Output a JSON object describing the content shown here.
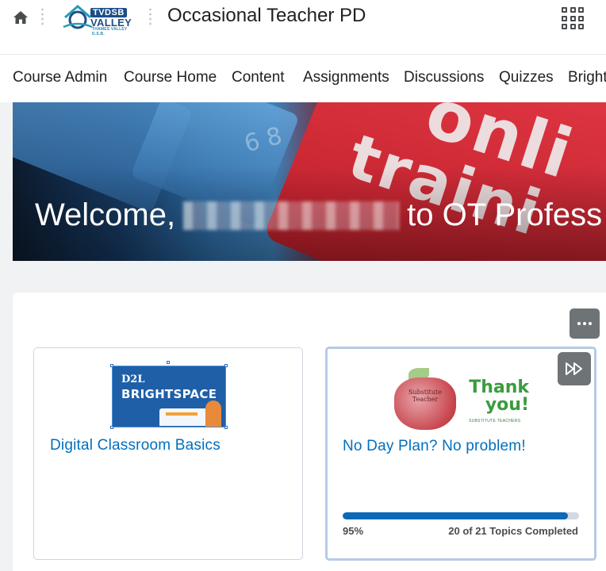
{
  "header": {
    "home_icon": "home-icon",
    "logo": {
      "line1": "TVDSB",
      "line2": "VALLEY",
      "line3": "THAMES VALLEY D.S.B."
    },
    "course_title": "Occasional Teacher PD",
    "apps_icon": "waffle-grid-icon"
  },
  "nav": {
    "items": [
      "Course Admin",
      "Course Home",
      "Content",
      "Assignments",
      "Discussions",
      "Quizzes",
      "Bright"
    ]
  },
  "banner": {
    "welcome_prefix": "Welcome,",
    "welcome_suffix": "to OT Profess",
    "bg_words": [
      "onli",
      "traini"
    ],
    "key_digit": "6 8"
  },
  "widget": {
    "more_icon": "more-options-icon",
    "cards": [
      {
        "title": "Digital Classroom Basics",
        "image": {
          "logo": "D2L",
          "name": "BRIGHTSPACE"
        }
      },
      {
        "title": "No Day Plan? No problem!",
        "image": {
          "apple_text": "Substitute Teacher",
          "headline": "Thank you!",
          "subline": "SUBSTITUTE TEACHERS"
        },
        "skip_icon": "fast-forward-icon",
        "progress": {
          "percent_label": "95%",
          "fraction": 0.952,
          "count_label": "20 of 21 Topics Completed"
        }
      }
    ]
  },
  "colors": {
    "link": "#006fbf",
    "progress": "#0d68b8",
    "button_gray": "#6e7376"
  }
}
